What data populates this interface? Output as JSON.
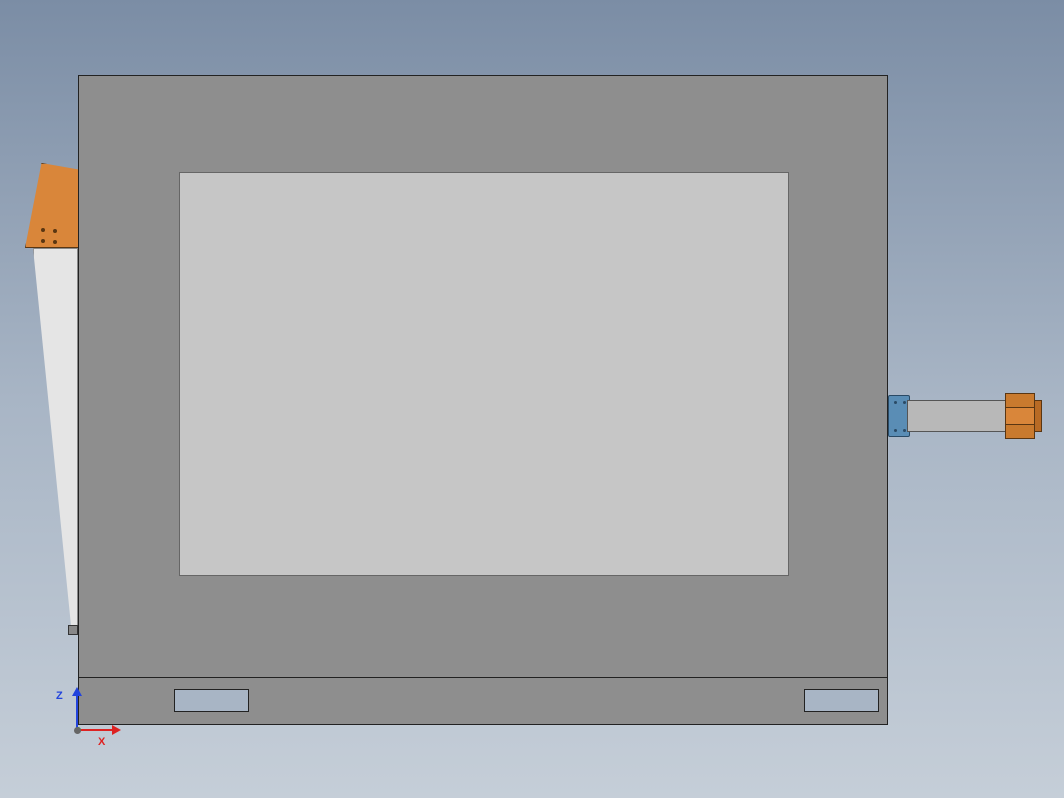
{
  "viewport": {
    "axes": {
      "x_label": "X",
      "z_label": "Z",
      "x_color": "#dd2222",
      "y_color": "#22aa22",
      "z_color": "#2244dd"
    }
  },
  "model": {
    "main_frame_color": "#8e8e8e",
    "inner_panel_color": "#c6c6c6",
    "bracket_color": "#d9863a",
    "blue_bracket_color": "#5a8db5"
  }
}
